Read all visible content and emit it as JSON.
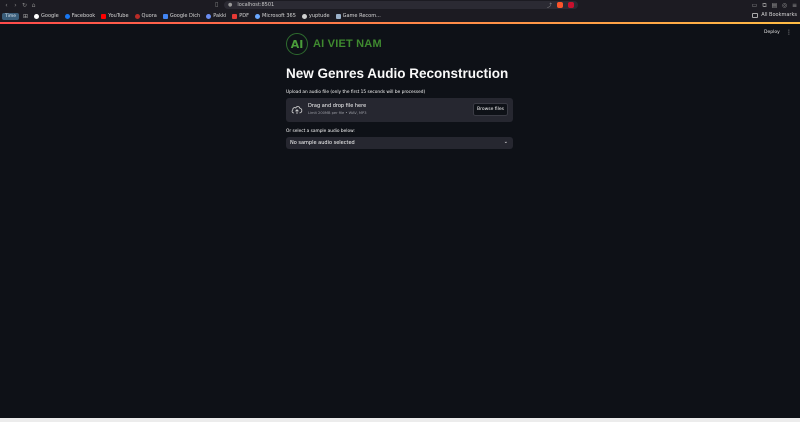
{
  "browser": {
    "url": "localhost:8501",
    "bookmarks": [
      {
        "label": "Time",
        "color": "#3a5d7a"
      },
      {
        "label": "Google",
        "color": "#ffffff"
      },
      {
        "label": "Facebook",
        "color": "#1877f2"
      },
      {
        "label": "YouTube",
        "color": "#ff0000"
      },
      {
        "label": "Quora",
        "color": "#b92b27"
      },
      {
        "label": "Google Dich",
        "color": "#4285f4"
      },
      {
        "label": "Pakki",
        "color": "#6a8df2"
      },
      {
        "label": "PDF",
        "color": "#e53935"
      },
      {
        "label": "Microsoft 365",
        "color": "#6aa8ff"
      },
      {
        "label": "yuptude",
        "color": "#cfcfcf"
      },
      {
        "label": "Game Recom...",
        "color": "#9ab0c9"
      }
    ],
    "all_bookmarks": "All Bookmarks",
    "accent": "#ff4b4b"
  },
  "app": {
    "deploy_label": "Deploy",
    "menu_icon": "kebab-menu-icon",
    "logo": {
      "mark": "AI",
      "text": "AI VIET NAM",
      "color": "#3f8a2f"
    },
    "title": "New Genres Audio Reconstruction",
    "upload": {
      "label": "Upload an audio file (only the first 15 seconds will be processed)",
      "drag_text": "Drag and drop file here",
      "limit_text": "Limit 200MB per file • WAV, MP3",
      "browse_label": "Browse files"
    },
    "sample": {
      "label": "Or select a sample audio below:",
      "selected": "No sample audio selected"
    }
  }
}
